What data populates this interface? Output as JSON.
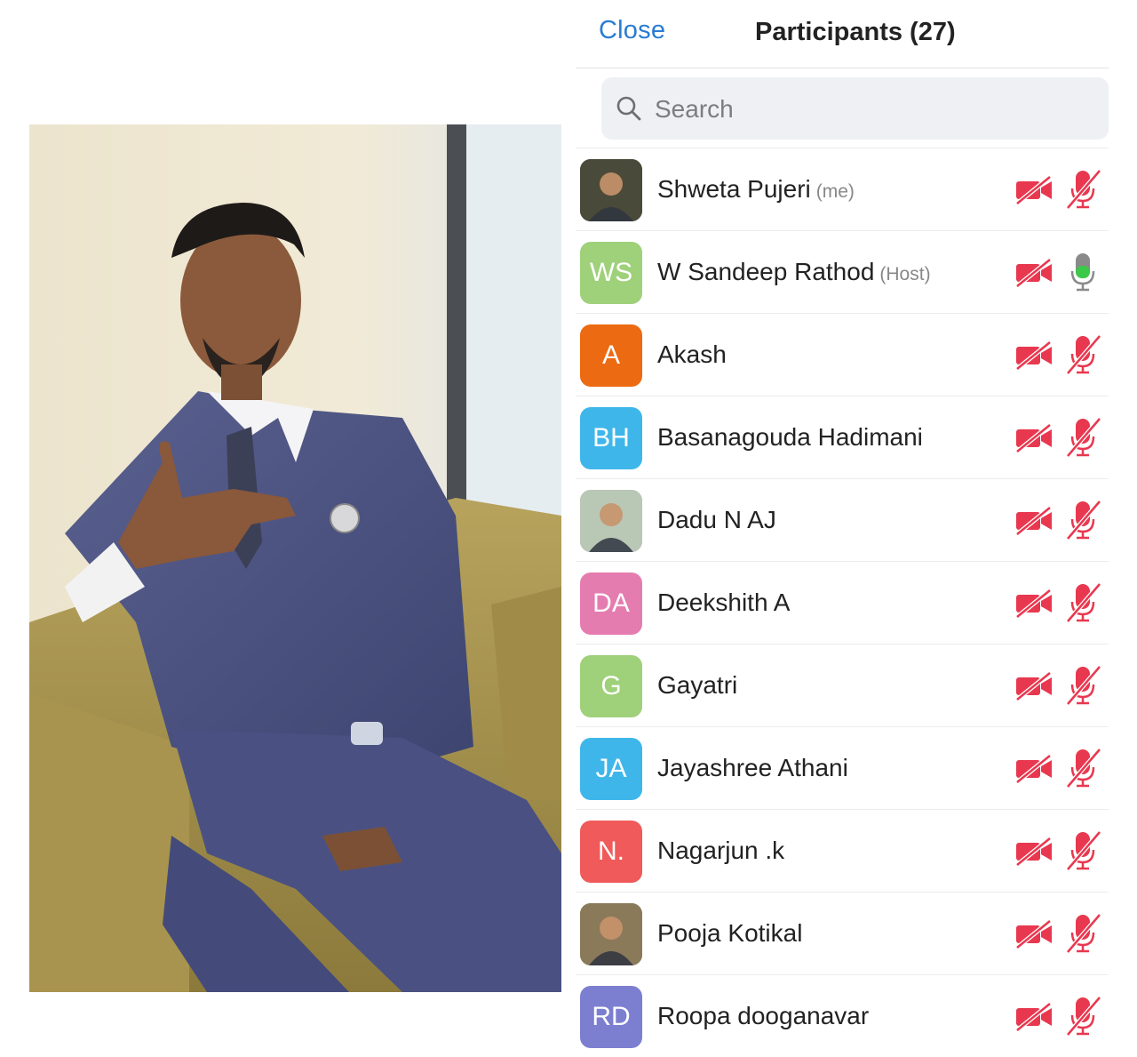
{
  "header": {
    "close_label": "Close",
    "title": "Participants (27)"
  },
  "search": {
    "placeholder": "Search",
    "icon": "search-icon"
  },
  "colors": {
    "link": "#2a7bd3",
    "muted_red": "#e8384f",
    "mic_on_green": "#3cc94a"
  },
  "participants": [
    {
      "name": "Shweta Pujeri",
      "tag": "(me)",
      "initials": "",
      "avatar_color": "#4a4a3a",
      "avatar_type": "photo",
      "video": "off",
      "audio": "muted"
    },
    {
      "name": "W Sandeep Rathod",
      "tag": "(Host)",
      "initials": "WS",
      "avatar_color": "#9fd07a",
      "avatar_type": "initials",
      "video": "off",
      "audio": "on"
    },
    {
      "name": "Akash",
      "tag": "",
      "initials": "A",
      "avatar_color": "#ec6a12",
      "avatar_type": "initials",
      "video": "off",
      "audio": "muted"
    },
    {
      "name": "Basanagouda Hadimani",
      "tag": "",
      "initials": "BH",
      "avatar_color": "#3fb6ea",
      "avatar_type": "initials",
      "video": "off",
      "audio": "muted"
    },
    {
      "name": "Dadu N AJ",
      "tag": "",
      "initials": "",
      "avatar_color": "#b9c7b5",
      "avatar_type": "photo",
      "video": "off",
      "audio": "muted"
    },
    {
      "name": "Deekshith A",
      "tag": "",
      "initials": "DA",
      "avatar_color": "#e57cb0",
      "avatar_type": "initials",
      "video": "off",
      "audio": "muted"
    },
    {
      "name": "Gayatri",
      "tag": "",
      "initials": "G",
      "avatar_color": "#9fd07a",
      "avatar_type": "initials",
      "video": "off",
      "audio": "muted"
    },
    {
      "name": "Jayashree Athani",
      "tag": "",
      "initials": "JA",
      "avatar_color": "#3fb6ea",
      "avatar_type": "initials",
      "video": "off",
      "audio": "muted"
    },
    {
      "name": "Nagarjun .k",
      "tag": "",
      "initials": "N.",
      "avatar_color": "#f05a5a",
      "avatar_type": "initials",
      "video": "off",
      "audio": "muted"
    },
    {
      "name": "Pooja Kotikal",
      "tag": "",
      "initials": "",
      "avatar_color": "#8a7a5a",
      "avatar_type": "photo",
      "video": "off",
      "audio": "muted"
    },
    {
      "name": "Roopa dooganavar",
      "tag": "",
      "initials": "RD",
      "avatar_color": "#7c7fd0",
      "avatar_type": "initials",
      "video": "off",
      "audio": "muted"
    }
  ]
}
